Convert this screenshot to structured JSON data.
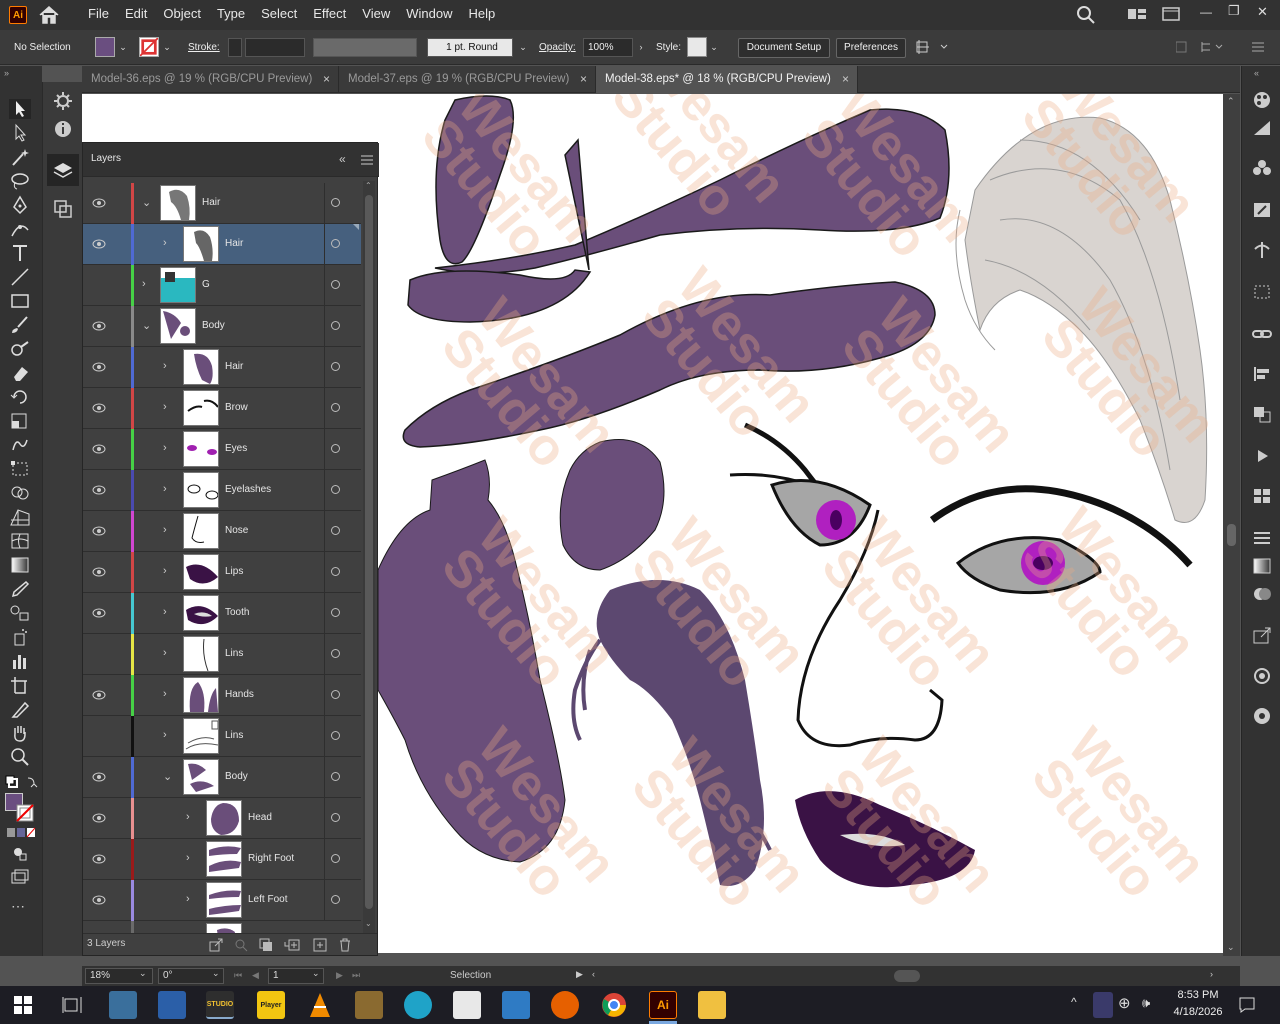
{
  "app": {
    "logo_text": "Ai",
    "accent": "#ff9a00"
  },
  "menu": [
    "File",
    "Edit",
    "Object",
    "Type",
    "Select",
    "Effect",
    "View",
    "Window",
    "Help"
  ],
  "control": {
    "selection_status": "No Selection",
    "fill_color": "#6a4e80",
    "stroke_label": "Stroke:",
    "stroke_profile": "1 pt. Round",
    "opacity_label": "Opacity:",
    "opacity_value": "100%",
    "style_label": "Style:",
    "document_setup": "Document Setup",
    "preferences": "Preferences"
  },
  "tabs": [
    {
      "label": "Model-36.eps @ 19 % (RGB/CPU Preview)",
      "close": "×"
    },
    {
      "label": "Model-37.eps @ 19 % (RGB/CPU Preview)",
      "close": "×"
    },
    {
      "label": "Model-38.eps* @ 18 % (RGB/CPU Preview)",
      "close": "×"
    }
  ],
  "layers_panel": {
    "title": "Layers",
    "collapse": "«",
    "footer_count": "3 Layers",
    "rows": [
      {
        "name": "Hair",
        "color": "#d14646",
        "visible": true
      },
      {
        "name": "Hair",
        "color": "#4f6ad3",
        "visible": true
      },
      {
        "name": "G",
        "color": "#46d146",
        "visible": false
      },
      {
        "name": "Body",
        "color": "#8a8a8a",
        "visible": true
      },
      {
        "name": "Hair",
        "color": "#4f6ad3",
        "visible": true
      },
      {
        "name": "Brow",
        "color": "#d14646",
        "visible": true
      },
      {
        "name": "Eyes",
        "color": "#46d146",
        "visible": true
      },
      {
        "name": "Eyelashes",
        "color": "#4a4ab0",
        "visible": true
      },
      {
        "name": "Nose",
        "color": "#d146d1",
        "visible": true
      },
      {
        "name": "Lips",
        "color": "#d14646",
        "visible": true
      },
      {
        "name": "Tooth",
        "color": "#46c8d1",
        "visible": true
      },
      {
        "name": "Lins",
        "color": "#e6e646",
        "visible": false
      },
      {
        "name": "Hands",
        "color": "#46d146",
        "visible": true
      },
      {
        "name": "Lins",
        "color": "#111111",
        "visible": false
      },
      {
        "name": "Body",
        "color": "#4f6ad3",
        "visible": true
      },
      {
        "name": "Head",
        "color": "#e89090",
        "visible": true
      },
      {
        "name": "Right Foot",
        "color": "#9a1a1a",
        "visible": true
      },
      {
        "name": "Left Foot",
        "color": "#9a8ae0",
        "visible": true
      }
    ]
  },
  "status": {
    "zoom": "18%",
    "rotation": "0°",
    "artboard": "1",
    "tool": "Selection"
  },
  "clock": {
    "time": "8:53 PM",
    "date": "4/18/2026"
  },
  "watermark": "Wesam\nStudio",
  "taskbar_icons": [
    "file-explorer-icon",
    "task-view-icon",
    "photos-icon",
    "game-icon",
    "studio-icon",
    "player-icon",
    "vlc-icon",
    "gimp-icon",
    "vector-app-icon",
    "inkscape-icon",
    "photo-viewer-icon",
    "firefox-icon",
    "chrome-icon",
    "illustrator-icon",
    "folder-icon"
  ],
  "icons": {
    "taskbar_studio": "STUDIO",
    "taskbar_player": "Player",
    "taskbar_ai": "Ai",
    "tray_chevron": "^",
    "tray_language": "⊕",
    "tray_volume": "🕪",
    "win_minimize": "—",
    "win_restore": "❐",
    "win_close": "✕",
    "page_first": "⏮",
    "page_prev": "◀",
    "page_next": "▶",
    "page_last": "⏭",
    "more_tools": "⋯"
  }
}
